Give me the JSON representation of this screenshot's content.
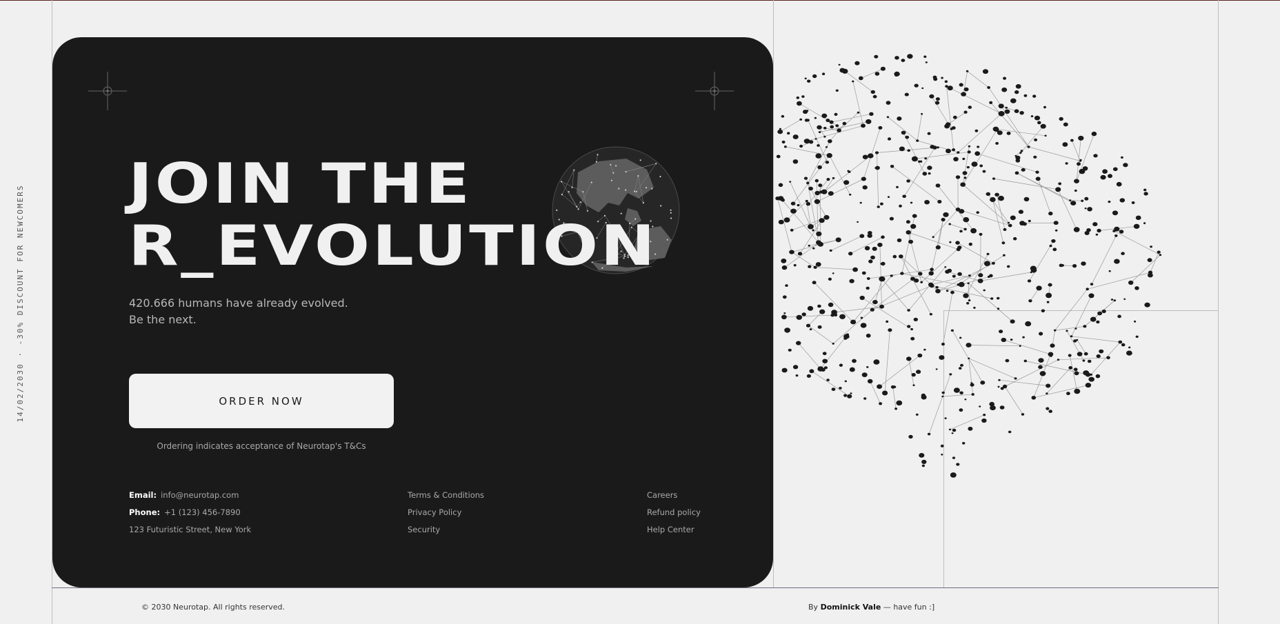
{
  "promo_side_text": "14/02/2030 · -30% DISCOUNT FOR NEWCOMERS",
  "hero": {
    "title_line1": "JOIN THE",
    "title_line2": "R_EVOLUTION",
    "subtitle_line1": "420.666 humans have already evolved.",
    "subtitle_line2": "Be the next."
  },
  "cta": {
    "order_label": "ORDER NOW",
    "terms_note": "Ordering indicates acceptance of Neurotap's T&Cs"
  },
  "contact": {
    "email_label": "Email:",
    "email_value": "info@neurotap.com",
    "phone_label": "Phone:",
    "phone_value": "+1 (123) 456-7890",
    "address": "123 Futuristic Street, New York"
  },
  "legal_links": [
    "Terms & Conditions",
    "Privacy Policy",
    "Security"
  ],
  "company_links": [
    "Careers",
    "Refund policy",
    "Help Center"
  ],
  "footer": {
    "copyright": "© 2030 Neurotap. All rights reserved.",
    "credit_prefix": "By",
    "credit_name": "Dominick Vale",
    "credit_suffix": "— have fun :]"
  },
  "colors": {
    "page_bg": "#f0f0f0",
    "card_bg": "#1a1a1a",
    "button_bg": "#f2f2f2",
    "network_node": "#1a1a1a",
    "network_edge": "#9a9a9a"
  },
  "icons": [
    "crosshair-icon",
    "globe-network-illustration",
    "brain-network-illustration"
  ]
}
